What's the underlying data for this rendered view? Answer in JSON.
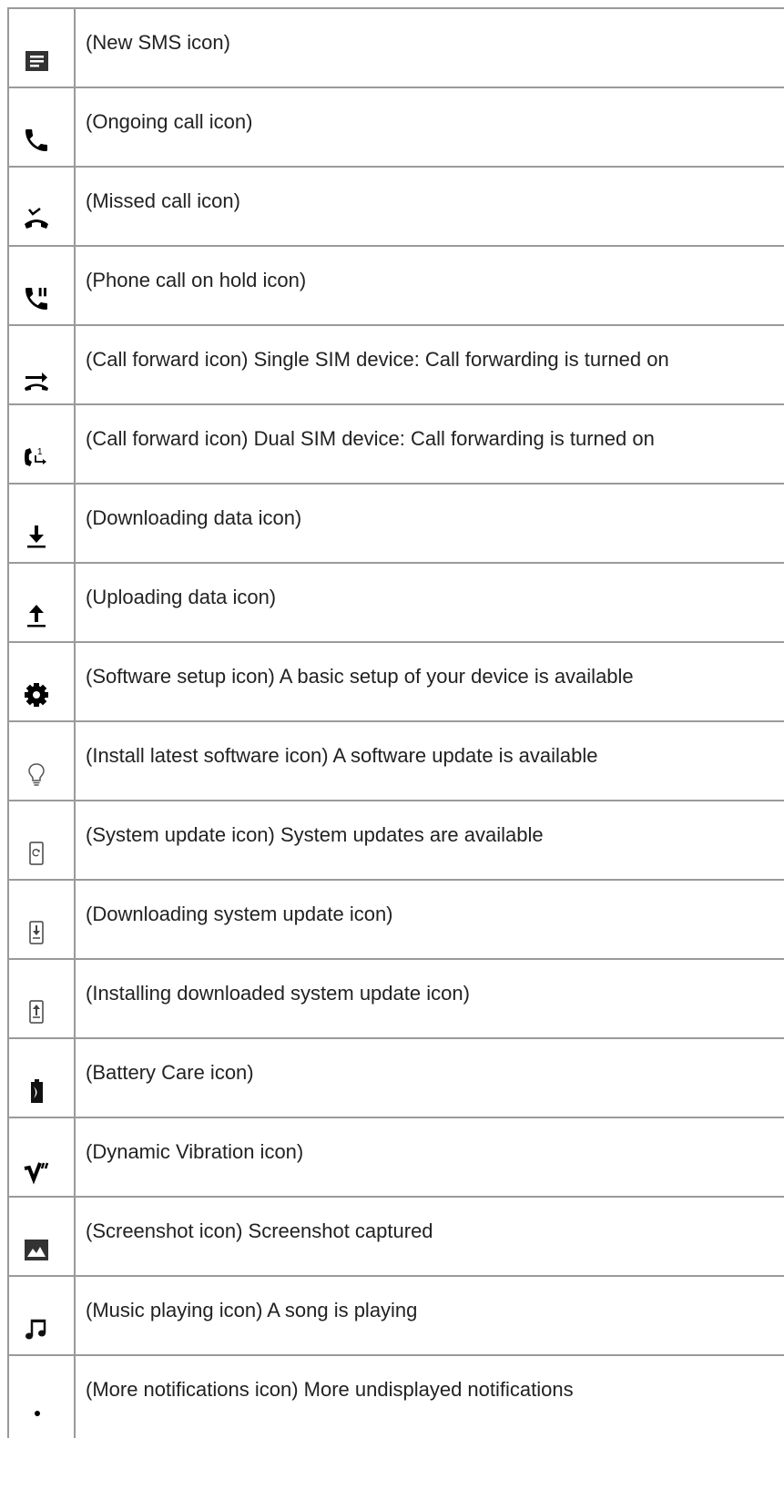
{
  "rows": [
    {
      "icon": "new-sms-icon",
      "text": "(New SMS icon)"
    },
    {
      "icon": "ongoing-call-icon",
      "text": "(Ongoing call icon)"
    },
    {
      "icon": "missed-call-icon",
      "text": "(Missed call icon)"
    },
    {
      "icon": "call-on-hold-icon",
      "text": "(Phone call on hold icon)"
    },
    {
      "icon": "call-forward-single-sim-icon",
      "text": "(Call forward icon) Single SIM device: Call forwarding is turned on"
    },
    {
      "icon": "call-forward-dual-sim-icon",
      "text": "(Call forward icon) Dual SIM device: Call forwarding is turned on"
    },
    {
      "icon": "downloading-data-icon",
      "text": "(Downloading data icon)"
    },
    {
      "icon": "uploading-data-icon",
      "text": "(Uploading data icon)"
    },
    {
      "icon": "software-setup-icon",
      "text": "(Software setup icon) A basic setup of your device is available"
    },
    {
      "icon": "install-latest-software-icon",
      "text": "(Install latest software icon) A software update is available"
    },
    {
      "icon": "system-update-icon",
      "text": "(System update icon) System updates are available"
    },
    {
      "icon": "downloading-system-update-icon",
      "text": "(Downloading system update icon)"
    },
    {
      "icon": "installing-system-update-icon",
      "text": "(Installing downloaded system update icon)"
    },
    {
      "icon": "battery-care-icon",
      "text": "(Battery Care icon)"
    },
    {
      "icon": "dynamic-vibration-icon",
      "text": "(Dynamic Vibration icon)"
    },
    {
      "icon": "screenshot-icon",
      "text": "(Screenshot icon) Screenshot captured"
    },
    {
      "icon": "music-playing-icon",
      "text": "(Music playing icon) A song is playing"
    },
    {
      "icon": "more-notifications-icon",
      "text": "(More notifications icon) More undisplayed notifications"
    }
  ]
}
